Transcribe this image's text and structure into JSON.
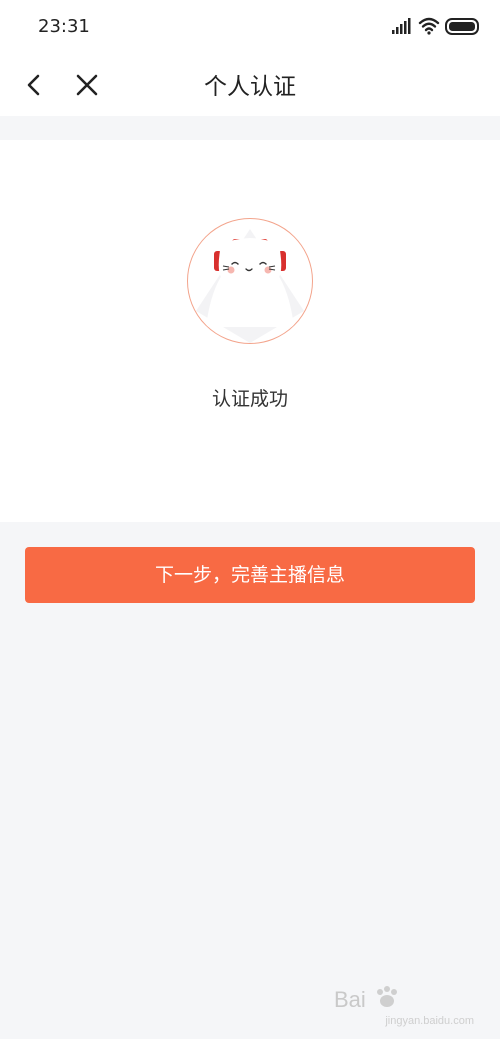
{
  "status_bar": {
    "time": "23:31",
    "icons": [
      "signal-icon",
      "wifi-icon",
      "battery-icon"
    ]
  },
  "nav": {
    "title": "个人认证",
    "icons": [
      "back-icon",
      "close-icon"
    ]
  },
  "result": {
    "message": "认证成功",
    "illustration": "cat-with-headphones-icon"
  },
  "actions": {
    "next_label": "下一步，完善主播信息"
  },
  "watermark": {
    "brand": "Bai",
    "sub": "jingyan.baidu.com"
  },
  "colors": {
    "accent": "#f86a44",
    "background": "#f5f6f8",
    "circle_border": "#f3a48c",
    "headphone_red": "#d8302e"
  }
}
